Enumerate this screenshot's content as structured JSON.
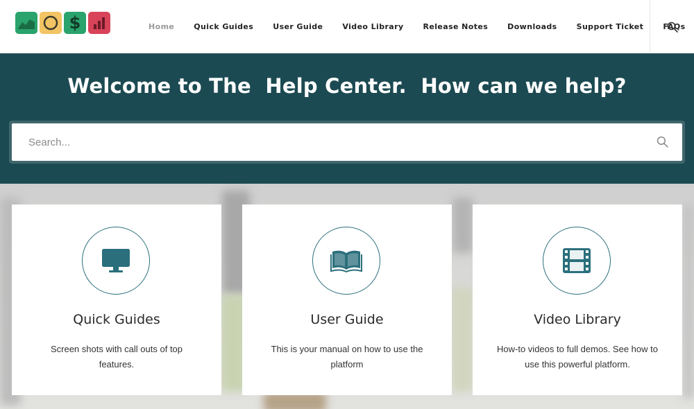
{
  "brand": {
    "tiles": [
      {
        "name": "chart-line-icon",
        "color": "#2aa36c"
      },
      {
        "name": "circle-icon",
        "color": "#f2c464"
      },
      {
        "name": "dollar-icon",
        "color": "#2aa36c"
      },
      {
        "name": "bar-chart-icon",
        "color": "#d8435a"
      }
    ],
    "dollar_glyph": "$"
  },
  "nav": {
    "items": [
      {
        "label": "Home",
        "active": true
      },
      {
        "label": "Quick Guides",
        "active": false
      },
      {
        "label": "User Guide",
        "active": false
      },
      {
        "label": "Video Library",
        "active": false
      },
      {
        "label": "Release Notes",
        "active": false
      },
      {
        "label": "Downloads",
        "active": false
      },
      {
        "label": "Support Ticket",
        "active": false
      },
      {
        "label": "FAQs",
        "active": false
      }
    ],
    "search_icon": "search-icon"
  },
  "hero": {
    "title": "Welcome to The  Help Center.  How can we help?",
    "search_placeholder": "Search...",
    "background": "#1c4a52"
  },
  "cards": [
    {
      "title": "Quick Guides",
      "description": "Screen shots with call outs of top features.",
      "icon": "monitor-icon"
    },
    {
      "title": "User Guide",
      "description": "This is your manual on how to use the platform",
      "icon": "book-icon"
    },
    {
      "title": "Video Library",
      "description": "How-to videos to full demos.  See how to use this powerful platform.",
      "icon": "film-icon"
    }
  ],
  "colors": {
    "accent": "#2b6f7c",
    "nav_active": "#9a9a9a"
  }
}
